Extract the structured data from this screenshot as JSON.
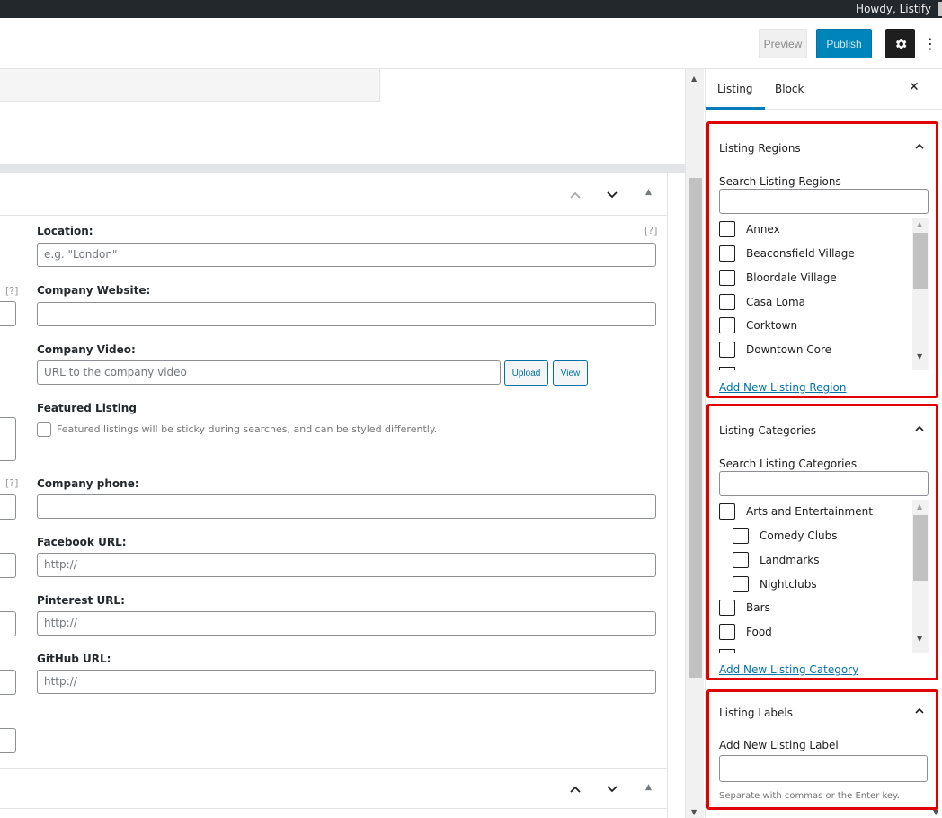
{
  "adminbar": {
    "greeting": "Howdy, Listify"
  },
  "topbar": {
    "preview_label": "Preview",
    "publish_label": "Publish"
  },
  "fields": {
    "location_label": "Location:",
    "location_placeholder": "e.g. \"London\"",
    "location_help": "[?]",
    "website_label": "Company Website:",
    "website_left_help": "[?]",
    "video_label": "Company Video:",
    "video_placeholder": "URL to the company video",
    "upload_label": "Upload",
    "view_label": "View",
    "featured_label": "Featured Listing",
    "featured_text": "Featured listings will be sticky during searches, and can be styled differently.",
    "phone_label": "Company phone:",
    "phone_left_help": "[?]",
    "facebook_label": "Facebook URL:",
    "facebook_placeholder": "http://",
    "pinterest_label": "Pinterest URL:",
    "pinterest_placeholder": "http://",
    "github_label": "GitHub URL:",
    "github_placeholder": "http://"
  },
  "sidebar": {
    "tabs": [
      {
        "label": "Listing"
      },
      {
        "label": "Block"
      }
    ],
    "regions": {
      "title": "Listing Regions",
      "search_label": "Search Listing Regions",
      "items": [
        "Annex",
        "Beaconsfield Village",
        "Bloordale Village",
        "Casa Loma",
        "Corktown",
        "Downtown Core"
      ],
      "add_link": "Add New Listing Region"
    },
    "categories": {
      "title": "Listing Categories",
      "search_label": "Search Listing Categories",
      "items": [
        "Arts and Entertainment",
        "Comedy Clubs",
        "Landmarks",
        "Nightclubs",
        "Bars",
        "Food"
      ],
      "add_link": "Add New Listing Category"
    },
    "labels": {
      "title": "Listing Labels",
      "add_label": "Add New Listing Label",
      "hint": "Separate with commas or the Enter key."
    }
  },
  "colors": {
    "publish": "#0085ba",
    "highlight": "#e10000",
    "link": "#0073aa"
  }
}
